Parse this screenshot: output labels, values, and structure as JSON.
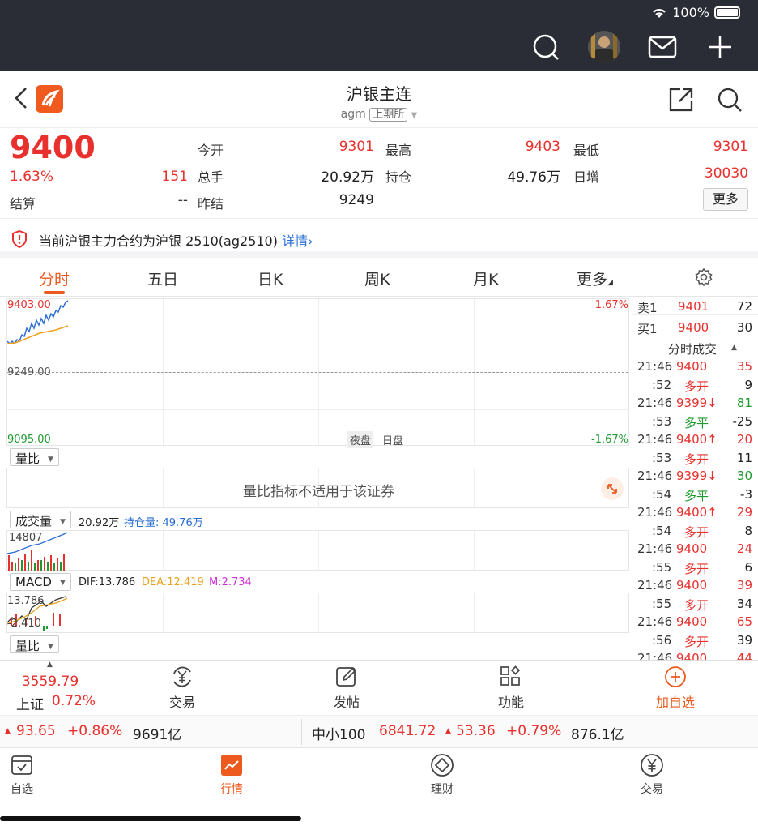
{
  "status": {
    "battery": "100%"
  },
  "header": {
    "title": "沪银主连",
    "code": "agm",
    "exchange": "上期所"
  },
  "quote": {
    "price": "9400",
    "change_pct": "1.63%",
    "change": "151",
    "settle_label": "结算",
    "settle_value": "--",
    "open_label": "今开",
    "open_value": "9301",
    "volume_label": "总手",
    "volume_value": "20.92万",
    "prev_settle_label": "昨结",
    "prev_settle_value": "9249",
    "high_label": "最高",
    "high_value": "9403",
    "oi_label": "持仓",
    "oi_value": "49.76万",
    "low_label": "最低",
    "low_value": "9301",
    "daily_inc_label": "日增",
    "daily_inc_value": "30030",
    "more_label": "更多"
  },
  "notice": {
    "text": "当前沪银主力合约为沪银 2510(ag2510)",
    "link": "详情"
  },
  "tabs": [
    "分时",
    "五日",
    "日K",
    "周K",
    "月K",
    "更多"
  ],
  "chart": {
    "price_top": "9403.00",
    "price_mid": "9249.00",
    "price_bottom": "9095.00",
    "pct_top": "1.67%",
    "pct_bottom": "-1.67%",
    "session_night": "夜盘",
    "session_day": "日盘",
    "ratio_ctrl": "量比",
    "ratio_msg": "量比指标不适用于该证券",
    "vol_ctrl": "成交量",
    "vol_value": "20.92万",
    "oi_text": "持仓量: 49.76万",
    "vol_top": "14807",
    "macd_ctrl": "MACD",
    "dif": "DIF:13.786",
    "dea": "DEA:12.419",
    "m": "M:2.734",
    "macd_top": "13.786",
    "macd_bottom": "-2.410",
    "ratio_ctrl2": "量比"
  },
  "book": {
    "sell_label": "卖1",
    "sell_price": "9401",
    "sell_vol": "72",
    "buy_label": "买1",
    "buy_price": "9400",
    "buy_vol": "30",
    "ticks_title": "分时成交",
    "ticks": [
      {
        "time": "21:46",
        "price": "9400",
        "vol": "35",
        "pc": "red",
        "vc": "red"
      },
      {
        "time": ":52",
        "price": "多开",
        "vol": "9",
        "pc": "red",
        "vc": "dark"
      },
      {
        "time": "21:46",
        "price": "9399↓",
        "vol": "81",
        "pc": "red",
        "vc": "green"
      },
      {
        "time": ":53",
        "price": "多平",
        "vol": "-25",
        "pc": "green",
        "vc": "dark"
      },
      {
        "time": "21:46",
        "price": "9400↑",
        "vol": "20",
        "pc": "red",
        "vc": "red"
      },
      {
        "time": ":53",
        "price": "多开",
        "vol": "11",
        "pc": "red",
        "vc": "dark"
      },
      {
        "time": "21:46",
        "price": "9399↓",
        "vol": "30",
        "pc": "red",
        "vc": "green"
      },
      {
        "time": ":54",
        "price": "多平",
        "vol": "-3",
        "pc": "green",
        "vc": "dark"
      },
      {
        "time": "21:46",
        "price": "9400↑",
        "vol": "29",
        "pc": "red",
        "vc": "red"
      },
      {
        "time": ":54",
        "price": "多开",
        "vol": "8",
        "pc": "red",
        "vc": "dark"
      },
      {
        "time": "21:46",
        "price": "9400",
        "vol": "24",
        "pc": "red",
        "vc": "red"
      },
      {
        "time": ":55",
        "price": "多开",
        "vol": "6",
        "pc": "red",
        "vc": "dark"
      },
      {
        "time": "21:46",
        "price": "9400",
        "vol": "39",
        "pc": "red",
        "vc": "red"
      },
      {
        "time": ":55",
        "price": "多开",
        "vol": "34",
        "pc": "red",
        "vc": "dark"
      },
      {
        "time": "21:46",
        "price": "9400",
        "vol": "65",
        "pc": "red",
        "vc": "red"
      },
      {
        "time": ":56",
        "price": "多开",
        "vol": "39",
        "pc": "red",
        "vc": "dark"
      },
      {
        "time": "21:46",
        "price": "9400",
        "vol": "44",
        "pc": "red",
        "vc": "red"
      }
    ]
  },
  "toolbar": {
    "index_value": "3559.79",
    "index_name": "上证",
    "index_pct": "0.72%",
    "trade": "交易",
    "post": "发帖",
    "func": "功能",
    "add_fav": "加自选"
  },
  "ticker": {
    "v1": "93.65",
    "p1": "+0.86%",
    "a1": "9691亿",
    "name2": "中小100",
    "v2": "6841.72",
    "c2": "53.36",
    "p2": "+0.79%",
    "a2": "876.1亿"
  },
  "nav": [
    "自选",
    "行情",
    "理财",
    "交易"
  ]
}
